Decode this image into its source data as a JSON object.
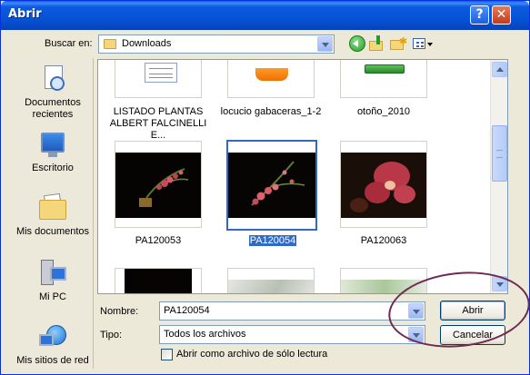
{
  "window": {
    "title": "Abrir",
    "help_glyph": "?",
    "close_glyph": "✕"
  },
  "toolbar": {
    "lookin_label": "Buscar en:",
    "lookin_value": "Downloads"
  },
  "places": [
    {
      "label": "Documentos recientes",
      "icon": "recent-documents-icon"
    },
    {
      "label": "Escritorio",
      "icon": "desktop-icon"
    },
    {
      "label": "Mis documentos",
      "icon": "my-documents-icon"
    },
    {
      "label": "Mi PC",
      "icon": "my-computer-icon"
    },
    {
      "label": "Mis sitios de red",
      "icon": "network-places-icon"
    }
  ],
  "files": [
    {
      "name": "LISTADO PLANTAS ALBERT FALCINELLI E...",
      "kind": "document"
    },
    {
      "name": "locucio gabaceras_1-2",
      "kind": "vlc"
    },
    {
      "name": "otoño_2010",
      "kind": "archive"
    },
    {
      "name": "PA120053",
      "kind": "photo"
    },
    {
      "name": "PA120054",
      "kind": "photo",
      "selected": true
    },
    {
      "name": "PA120063",
      "kind": "photo"
    }
  ],
  "bottom": {
    "filename_label": "Nombre:",
    "filename_value": "PA120054",
    "type_label": "Tipo:",
    "type_value": "Todos los archivos",
    "readonly_label": "Abrir como archivo de sólo lectura",
    "open_button": "Abrir",
    "cancel_button": "Cancelar"
  },
  "colors": {
    "titlebar": "#0653d6",
    "selection": "#316ac5",
    "annotation": "#6e2a52"
  }
}
